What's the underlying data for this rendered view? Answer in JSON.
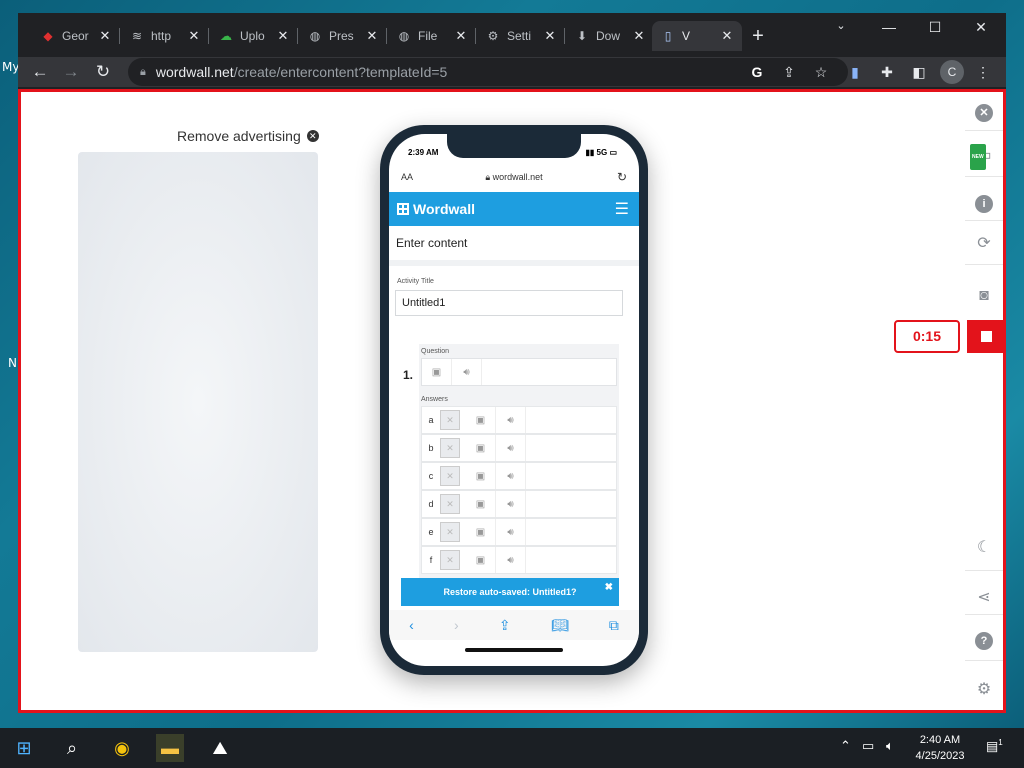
{
  "desktop": {
    "label_my": "My",
    "label_n": "N"
  },
  "browser": {
    "tabs": [
      {
        "label": "Geor",
        "icon": "cardinal-icon"
      },
      {
        "label": "http",
        "icon": "stack-icon"
      },
      {
        "label": "Uplo",
        "icon": "cloud-upload-icon"
      },
      {
        "label": "Pres",
        "icon": "globe-icon"
      },
      {
        "label": "File",
        "icon": "globe-icon"
      },
      {
        "label": "Setti",
        "icon": "gear-icon"
      },
      {
        "label": "Dow",
        "icon": "download-icon"
      },
      {
        "label": "V",
        "icon": "document-icon"
      }
    ],
    "url_host": "wordwall.net",
    "url_path": "/create/entercontent?templateId=5",
    "avatar_initial": "C"
  },
  "page": {
    "remove_advertising": "Remove advertising",
    "timer": "0:15",
    "new_badge": "NEW"
  },
  "phone": {
    "status_time": "2:39 AM",
    "status_signal": "5G",
    "text_size": "AA",
    "address": "wordwall.net",
    "brand": "Wordwall",
    "enter_content": "Enter content",
    "activity_title_label": "Activity Title",
    "activity_title_value": "Untitled1",
    "question_number": "1.",
    "question_label": "Question",
    "answers_label": "Answers",
    "answers": [
      "a",
      "b",
      "c",
      "d",
      "e",
      "f"
    ],
    "restore_prefix": "Restore auto-saved: ",
    "restore_name": "Untitled1?"
  },
  "taskbar": {
    "time": "2:40 AM",
    "date": "4/25/2023",
    "notifications": "1"
  },
  "colors": {
    "accent": "#1e9ee0",
    "record_red": "#e3131b"
  }
}
